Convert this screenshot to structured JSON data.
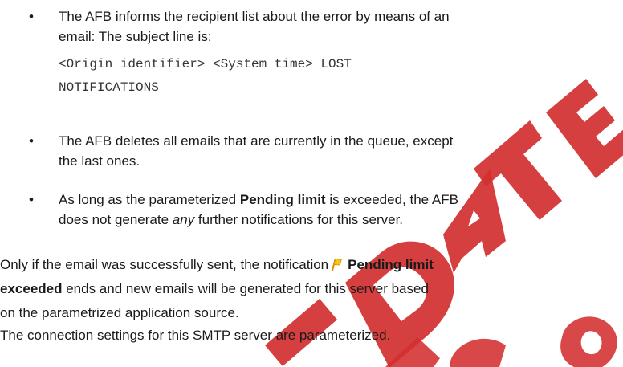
{
  "bullets": [
    {
      "line1": "The AFB informs the recipient list about the error by means of an",
      "line2": "email: The subject line is:"
    },
    {
      "line1": "The AFB deletes all emails that are currently in the queue, except",
      "line2": "the last ones."
    },
    {
      "line1_pre": "As long as the parameterized ",
      "line1_bold": "Pending limit",
      "line1_post": " is exceeded, the AFB",
      "line2_pre": "does not generate ",
      "line2_italic": "any",
      "line2_post": " further notifications for this server."
    }
  ],
  "code": {
    "line1": "<Origin identifier> <System time> LOST",
    "line2": "NOTIFICATIONS"
  },
  "paragraph1": {
    "line1_pre": "Only if the email was successfully sent, the notification",
    "line1_bold": "Pending limit",
    "line2_bold": "exceeded",
    "line2_post": " ends and new emails will be generated for this server based",
    "line3": "on the parametrized application source."
  },
  "paragraph2": "The connection settings for this SMTP server are parameterized.",
  "icons": {
    "notification": "flag-icon"
  },
  "colors": {
    "watermark": "#d32f2f",
    "flag_yellow": "#f5c518",
    "flag_pole": "#e08a00"
  }
}
